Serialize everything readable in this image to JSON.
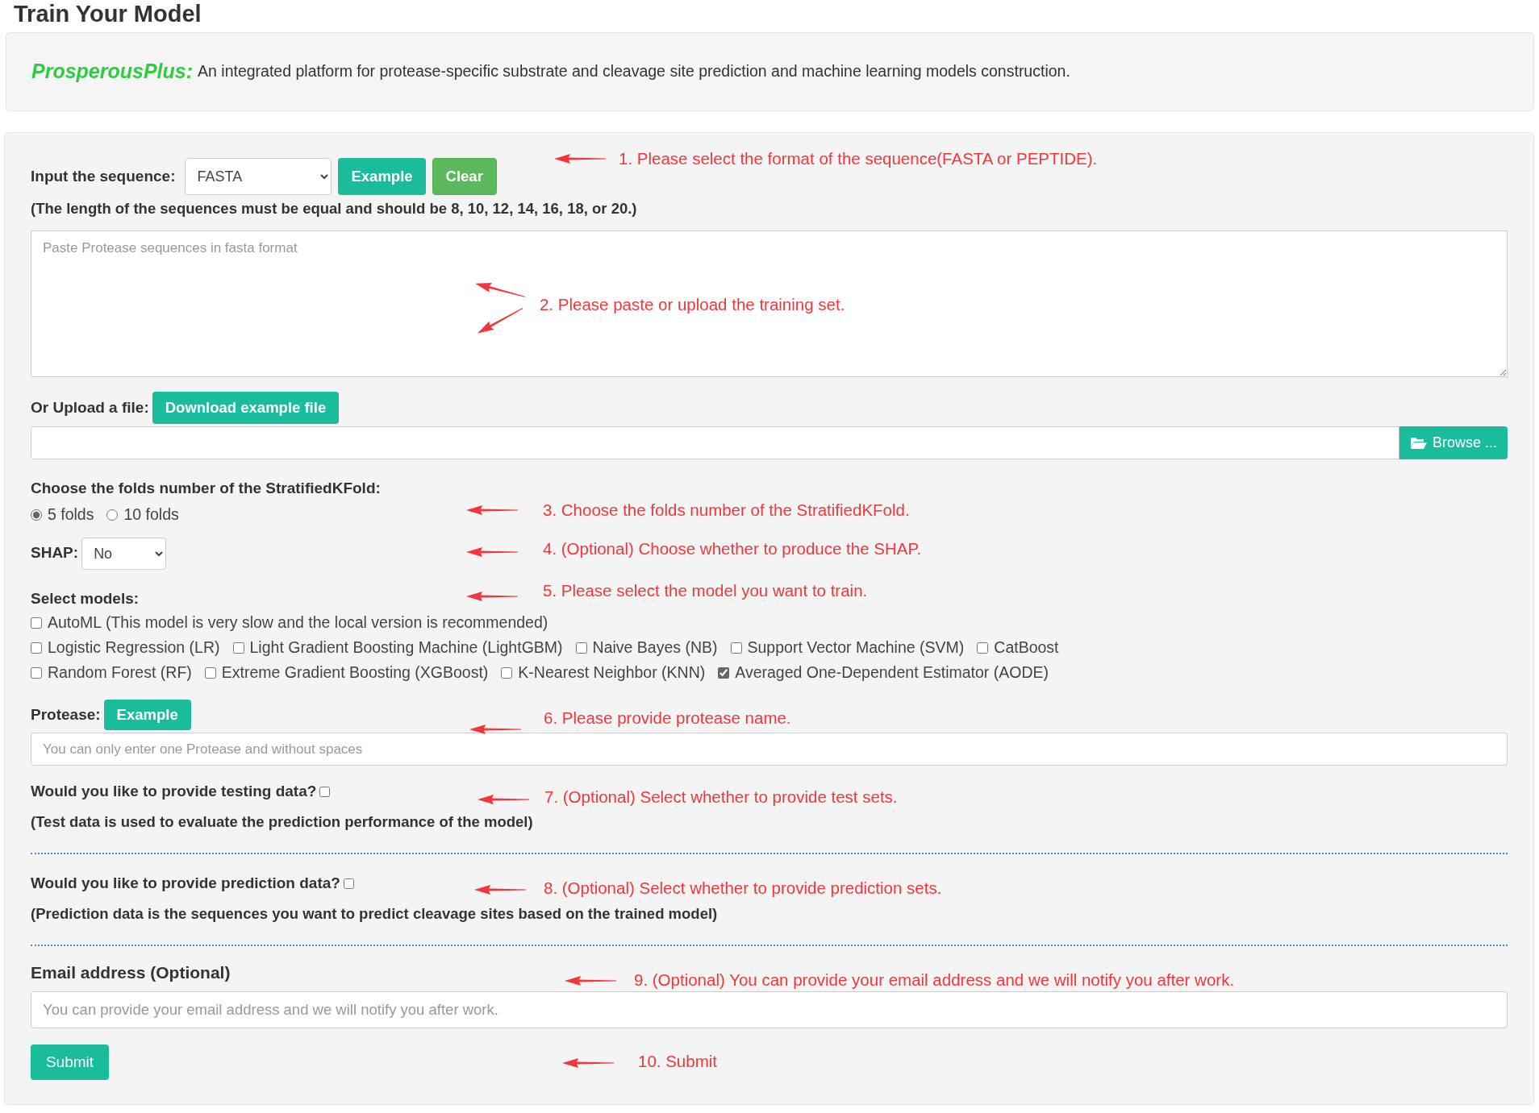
{
  "page_title": "Train Your Model",
  "intro": {
    "brand": "ProsperousPlus:",
    "text": "An integrated platform for protease-specific substrate and cleavage site prediction and machine learning models construction."
  },
  "sequence": {
    "label": "Input the sequence:",
    "format": "FASTA",
    "example_button": "Example",
    "clear_button": "Clear",
    "note": "(The length of the sequences must be equal and should be 8, 10, 12, 14, 16, 18, or 20.)",
    "placeholder": "Paste Protease sequences in fasta format"
  },
  "upload": {
    "label": "Or Upload a file:",
    "download_button": "Download example file",
    "browse_button": "Browse ..."
  },
  "folds": {
    "label": "Choose the folds number of the StratifiedKFold:",
    "options": [
      {
        "label": "5 folds",
        "selected": true
      },
      {
        "label": "10 folds",
        "selected": false
      }
    ]
  },
  "shap": {
    "label": "SHAP:",
    "value": "No"
  },
  "models": {
    "label": "Select models:",
    "rows": [
      [
        {
          "label": "AutoML (This model is very slow and the local version is recommended)",
          "checked": false
        }
      ],
      [
        {
          "label": "Logistic Regression (LR)",
          "checked": false
        },
        {
          "label": "Light Gradient Boosting Machine (LightGBM)",
          "checked": false
        },
        {
          "label": "Naive Bayes (NB)",
          "checked": false
        },
        {
          "label": "Support Vector Machine (SVM)",
          "checked": false
        },
        {
          "label": "CatBoost",
          "checked": false
        }
      ],
      [
        {
          "label": "Random Forest (RF)",
          "checked": false
        },
        {
          "label": "Extreme Gradient Boosting (XGBoost)",
          "checked": false
        },
        {
          "label": "K-Nearest Neighbor (KNN)",
          "checked": false
        },
        {
          "label": "Averaged One-Dependent Estimator (AODE)",
          "checked": true
        }
      ]
    ]
  },
  "protease": {
    "label": "Protease:",
    "example_button": "Example",
    "placeholder": "You can only enter one Protease and without spaces"
  },
  "testing": {
    "label": "Would you like to provide testing data?",
    "checked": false,
    "note": "(Test data is used to evaluate the prediction performance of the model)"
  },
  "prediction": {
    "label": "Would you like to provide prediction data?",
    "checked": false,
    "note": "(Prediction data is the sequences you want to predict cleavage sites based on the trained model)"
  },
  "email": {
    "label": "Email address (Optional)",
    "placeholder": "You can provide your email address and we will notify you after work."
  },
  "submit_button": "Submit",
  "annotations": [
    "1. Please select the format of the sequence(FASTA or PEPTIDE).",
    "2. Please paste or upload the training set.",
    "3. Choose the folds number of the StratifiedKFold.",
    "4. (Optional) Choose whether to produce the SHAP.",
    "5. Please select the model you want to train.",
    "6. Please provide protease name.",
    "7. (Optional) Select whether to provide test sets.",
    "8. (Optional) Select whether to provide prediction sets.",
    "9. (Optional) You can provide your email address and we will notify you after work.",
    "10. Submit"
  ]
}
